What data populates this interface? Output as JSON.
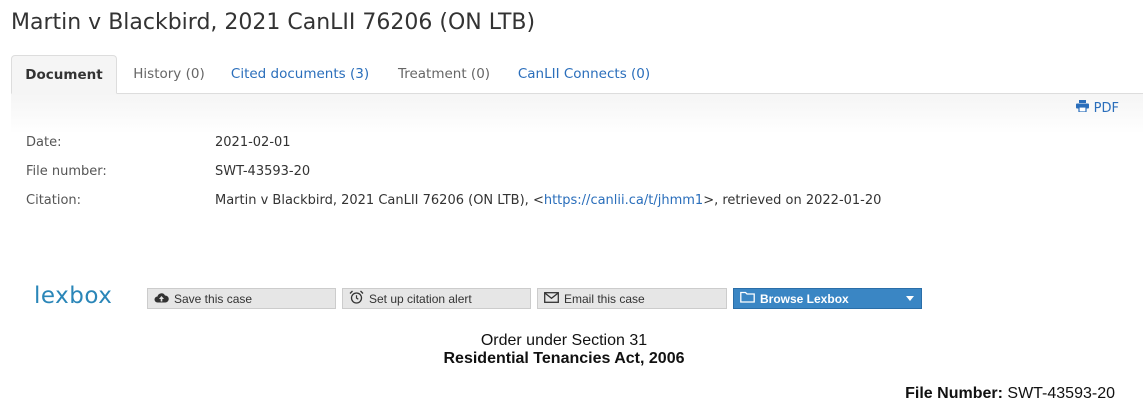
{
  "page": {
    "title": "Martin v Blackbird, 2021 CanLII 76206 (ON LTB)"
  },
  "tabs": [
    {
      "label": "Document"
    },
    {
      "label": "History (0)"
    },
    {
      "label": "Cited documents (3)"
    },
    {
      "label": "Treatment (0)"
    },
    {
      "label": "CanLII Connects (0)"
    }
  ],
  "pdf": {
    "label": "PDF"
  },
  "metadata": {
    "date": {
      "label": "Date:",
      "value": "2021-02-01"
    },
    "file_number": {
      "label": "File number:",
      "value": "SWT-43593-20"
    },
    "citation": {
      "label": "Citation:",
      "prefix": "Martin v Blackbird, 2021 CanLII 76206 (ON LTB), <",
      "link": "https://canlii.ca/t/jhmm1",
      "suffix": ">, retrieved on 2022-01-20"
    }
  },
  "lexbox": {
    "logo": "lexbox",
    "save": "Save this case",
    "alert": "Set up citation alert",
    "email": "Email this case",
    "browse": "Browse Lexbox"
  },
  "document": {
    "line1": "Order under Section 31",
    "line2": "Residential Tenancies Act, 2006",
    "file_number_label": "File Number:",
    "file_number_value": "SWT-43593-20"
  },
  "colors": {
    "link": "#2a6ebb",
    "lexbox_brand": "#2a86b8",
    "primary_button": "#3a86c4"
  }
}
